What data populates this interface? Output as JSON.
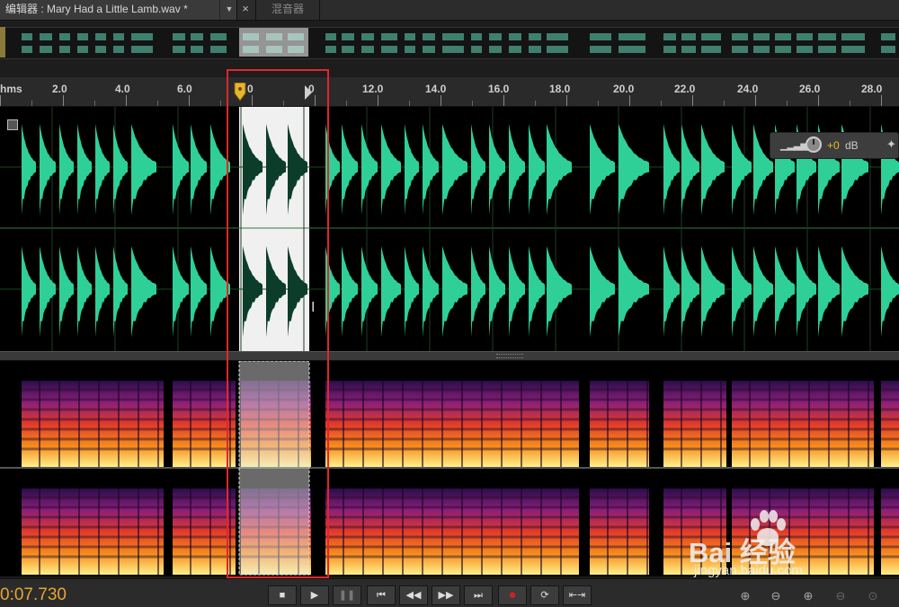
{
  "tabs": {
    "editor": "编辑器 : Mary Had a Little Lamb.wav *",
    "close": "×",
    "mixer": "混音器"
  },
  "ruler": {
    "unit": "hms",
    "labels": [
      "2.0",
      "4.0",
      "6.0",
      "0",
      "0",
      "12.0",
      "14.0",
      "16.0",
      "18.0",
      "20.0",
      "22.0",
      "24.0",
      "26.0",
      "28.0"
    ]
  },
  "hud": {
    "gain": "+0",
    "unit": "dB"
  },
  "transport": {
    "time": "0:07.730",
    "buttons": [
      "stop",
      "play",
      "pause",
      "skip-to-start",
      "rewind",
      "fast-forward",
      "skip-to-end",
      "record",
      "loop",
      "skip-selection"
    ]
  },
  "colors": {
    "waveform": "#2fcf98",
    "selection_waveform": "#0b3d2a",
    "selection": "#f0f0f0",
    "highlight_box": "#e0262a",
    "timecode": "#e7a633"
  },
  "watermark": {
    "logo": "Bai 经验",
    "url": "jingyan.baidu.com"
  }
}
